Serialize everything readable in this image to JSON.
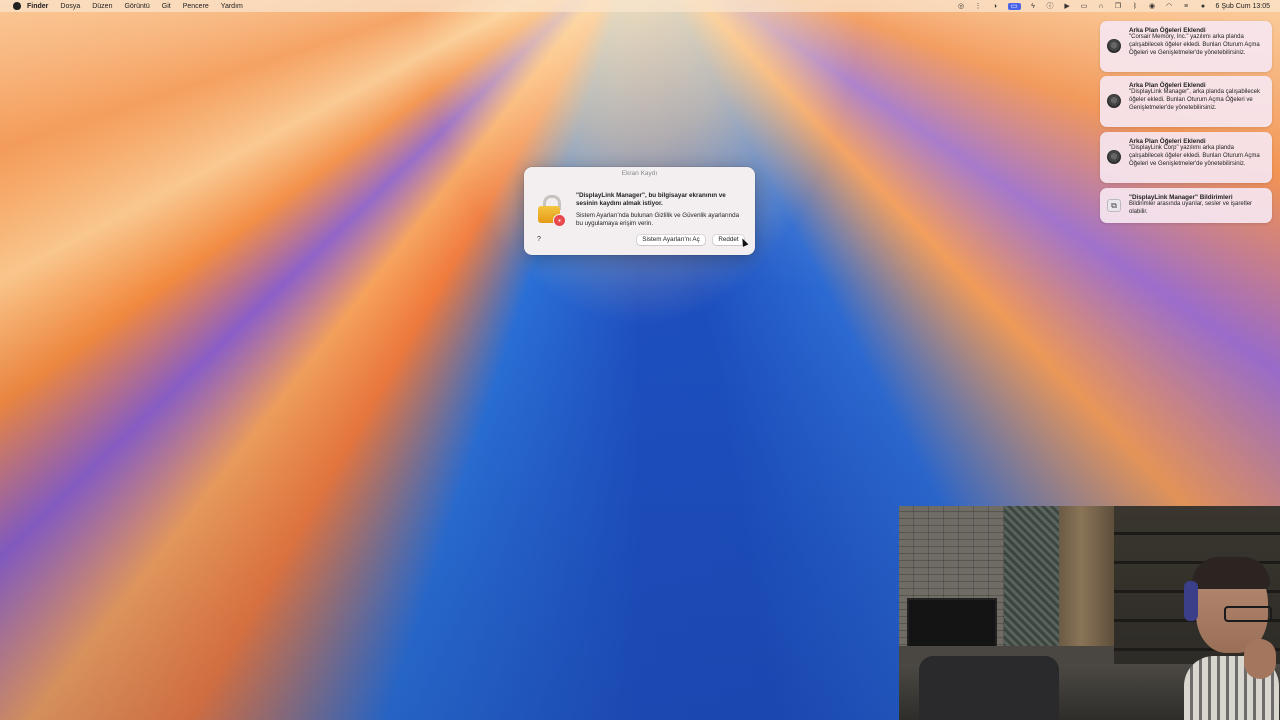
{
  "menubar": {
    "app": "Finder",
    "menus": [
      "Dosya",
      "Düzen",
      "Görüntü",
      "Git",
      "Pencere",
      "Yardım"
    ],
    "status_icons": [
      "display-icon",
      "dots-icon",
      "scroll-icon",
      "screen-mirror-icon",
      "bolt-icon",
      "info-icon",
      "play-icon",
      "monitor-icon",
      "headphones-icon",
      "window-icon",
      "bluetooth-icon",
      "record-icon",
      "wifi-icon",
      "control-center-icon",
      "siri-icon"
    ],
    "clock": "6 Şub Cum  13:05"
  },
  "notifications": [
    {
      "title": "Arka Plan Öğeleri Eklendi",
      "body": "\"Corsair Memory, Inc.\" yazılımı arka planda çalışabilecek öğeler ekledi. Bunları Oturum Açma Öğeleri ve Genişletmeler'de yönetebilirsiniz.",
      "icon": "gear-icon"
    },
    {
      "title": "Arka Plan Öğeleri Eklendi",
      "body": "\"DisplayLink Manager\", arka planda çalışabilecek öğeler ekledi. Bunları Oturum Açma Öğeleri ve Genişletmeler'de yönetebilirsiniz.",
      "icon": "gear-icon"
    },
    {
      "title": "Arka Plan Öğeleri Eklendi",
      "body": "\"DisplayLink Corp\" yazılımı arka planda çalışabilecek öğeler ekledi. Bunları Oturum Açma Öğeleri ve Genişletmeler'de yönetebilirsiniz.",
      "icon": "gear-icon"
    },
    {
      "title": "\"DisplayLink Manager\" Bildirimleri",
      "body": "Bildirimler arasında uyarılar, sesler ve işaretler olabilir.",
      "icon": "monitor-icon"
    }
  ],
  "dialog": {
    "title": "Ekran Kaydı",
    "heading": "\"DisplayLink Manager\", bu bilgisayar ekranının ve sesinin kaydını almak istiyor.",
    "body": "Sistem Ayarları'nda bulunan Gizlilik ve Güvenlik ayarlarında bu uygulamaya erişim verin.",
    "help": "?",
    "open_button": "Sistem Ayarları'nı Aç",
    "deny_button": "Reddet"
  }
}
